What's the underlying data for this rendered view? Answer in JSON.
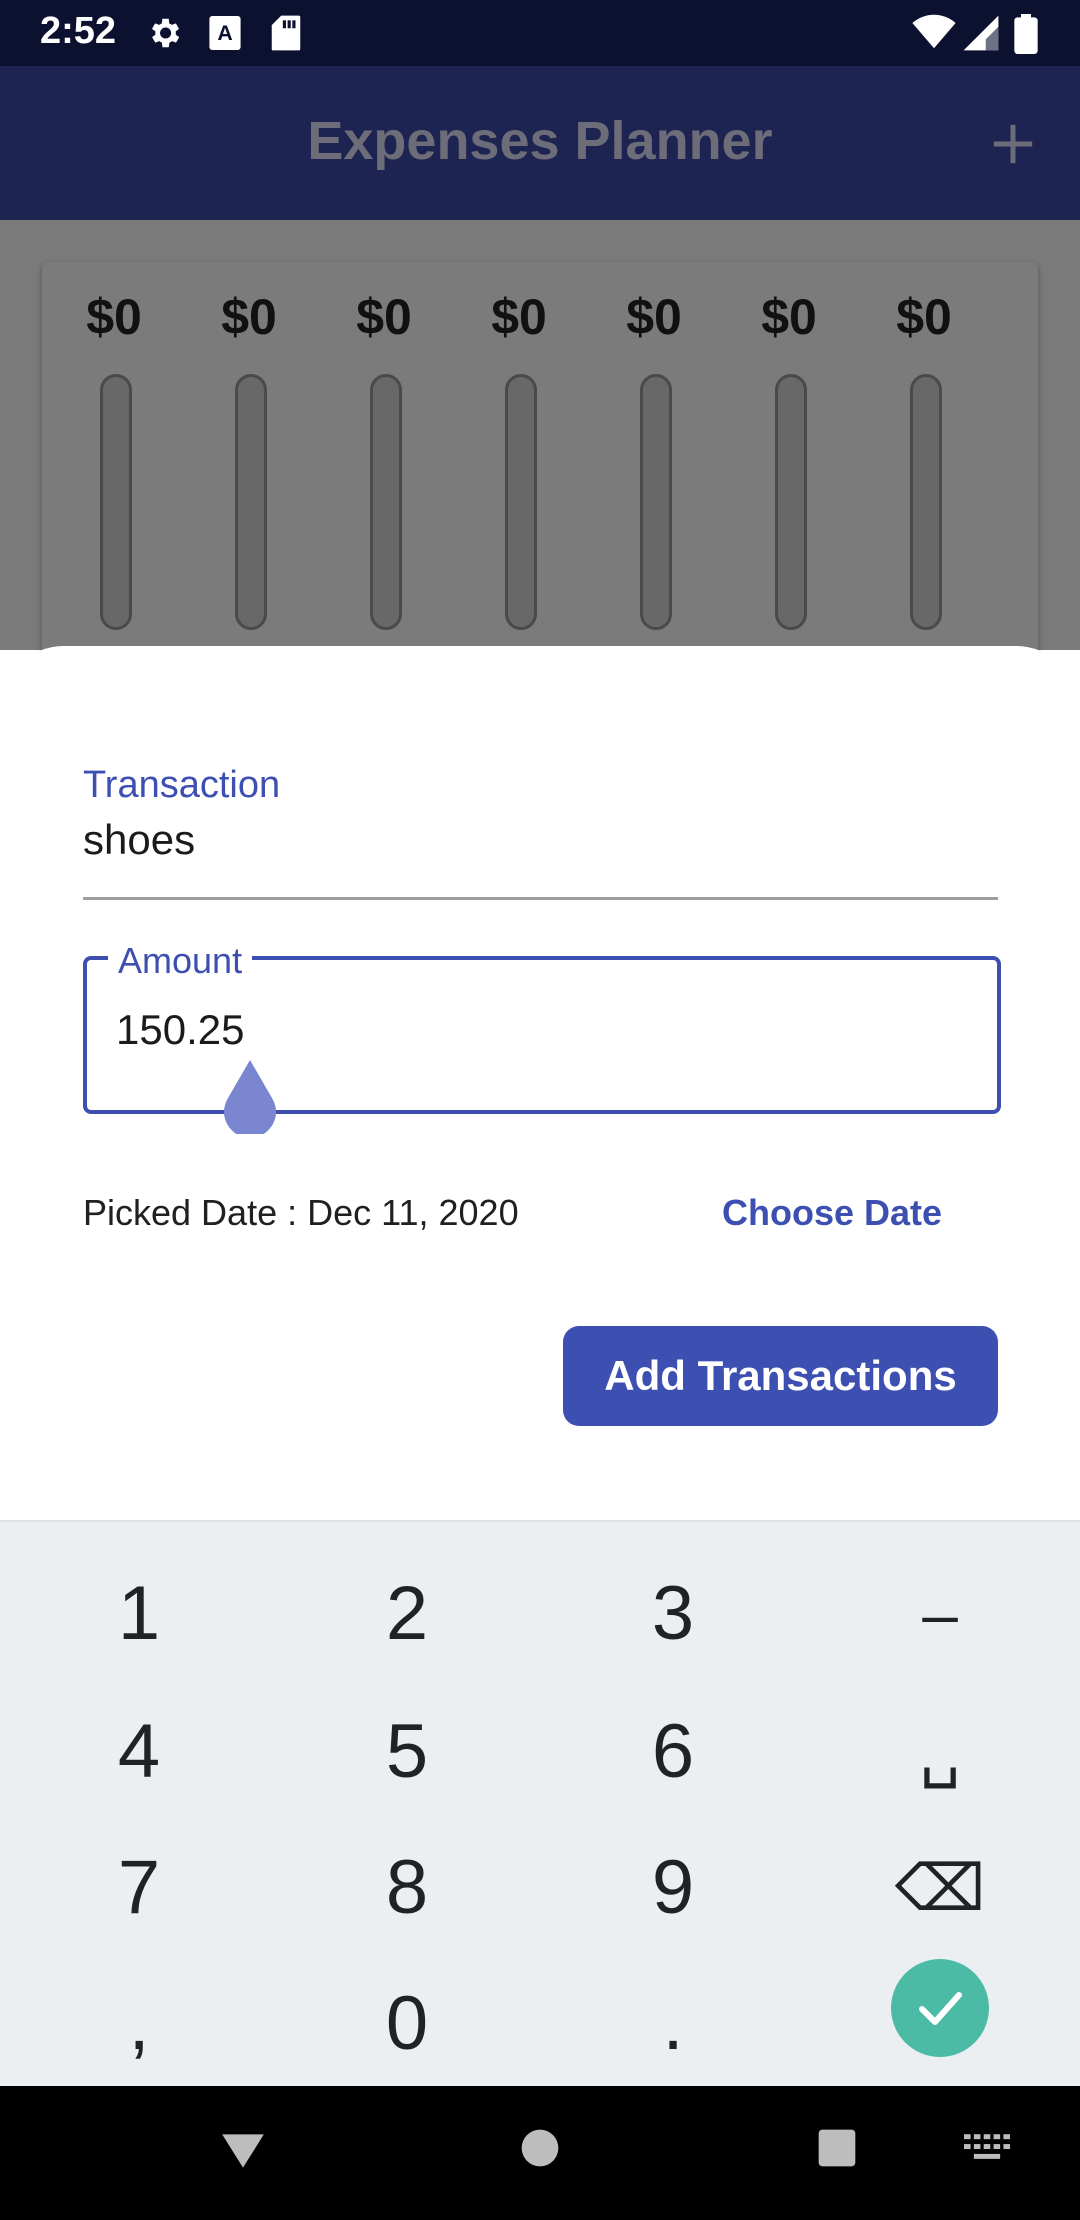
{
  "status_bar": {
    "time": "2:52",
    "icons": [
      "gear-icon",
      "a-icon",
      "sd-card-icon",
      "wifi-icon",
      "signal-icon",
      "battery-icon"
    ]
  },
  "app_bar": {
    "title": "Expenses Planner",
    "action_icon": "plus-icon"
  },
  "chart": {
    "days": [
      {
        "amount": "$0",
        "fill": 0
      },
      {
        "amount": "$0",
        "fill": 0
      },
      {
        "amount": "$0",
        "fill": 0
      },
      {
        "amount": "$0",
        "fill": 0
      },
      {
        "amount": "$0",
        "fill": 0
      },
      {
        "amount": "$0",
        "fill": 0
      },
      {
        "amount": "$0",
        "fill": 0
      }
    ]
  },
  "sheet": {
    "transaction_label": "Transaction",
    "transaction_value": "shoes",
    "amount_label": "Amount",
    "amount_value": "150.25",
    "picked_date_text": "Picked Date : Dec 11, 2020",
    "choose_date_label": "Choose Date",
    "add_button_label": "Add Transactions"
  },
  "keyboard": {
    "keys": [
      "1",
      "2",
      "3",
      "–",
      "4",
      "5",
      "6",
      "␣",
      "7",
      "8",
      "9",
      "⌫",
      ",",
      "0",
      ".",
      "✓"
    ],
    "check_color": "#4bbba5"
  },
  "nav_bar": {
    "icons": [
      "back-icon",
      "home-icon",
      "recents-icon",
      "keyboard-icon"
    ]
  },
  "colors": {
    "primary": "#3d4fb0",
    "app_bar": "#1e2452",
    "status_bar": "#0d1130",
    "scrim": "#7a7a7a"
  }
}
